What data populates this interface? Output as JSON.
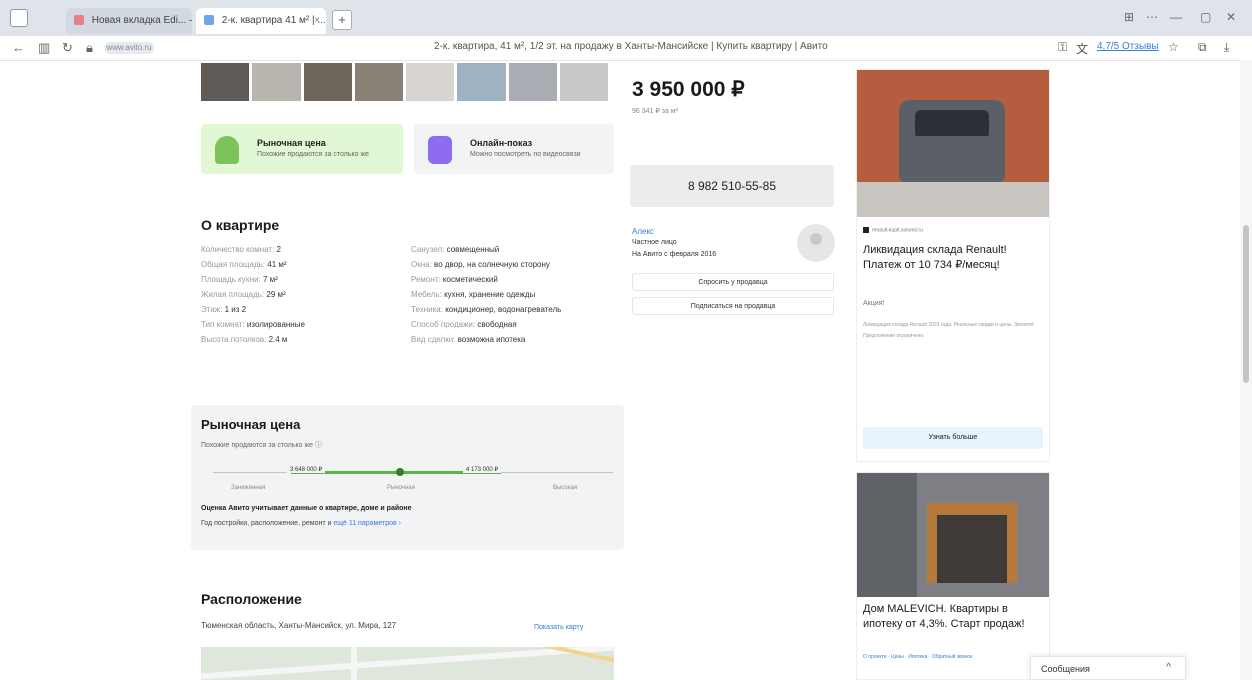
{
  "browser": {
    "tabs": [
      {
        "label": "Новая вкладка Edi... — Rev"
      },
      {
        "label": "2-к. квартира 41 м² | ..."
      }
    ],
    "new_tab": "+",
    "url": "www.avito.ru",
    "page_title": "2-к. квартира, 41 м², 1/2 эт. на продажу в Ханты-Мансийске | Купить квартиру | Авито",
    "rating": "4,7/5 Отзывы",
    "colors": {
      "accent": "#3a7bd5",
      "green": "#5bb648"
    }
  },
  "listing": {
    "market_badge": {
      "title": "Рыночная цена",
      "subtitle": "Похожие продаются за столько же"
    },
    "online_badge": {
      "title": "Онлайн-показ",
      "subtitle": "Можно посмотреть по видеосвязи"
    },
    "about": {
      "title": "О квартире",
      "left": [
        {
          "k": "Количество комнат:",
          "v": "2"
        },
        {
          "k": "Общая площадь:",
          "v": "41 м²"
        },
        {
          "k": "Площадь кухни:",
          "v": "7 м²"
        },
        {
          "k": "Жилая площадь:",
          "v": "29 м²"
        },
        {
          "k": "Этаж:",
          "v": "1 из 2"
        },
        {
          "k": "Тип комнат:",
          "v": "изолированные"
        },
        {
          "k": "Высота потолков:",
          "v": "2.4 м"
        }
      ],
      "right": [
        {
          "k": "Санузел:",
          "v": "совмещенный"
        },
        {
          "k": "Окна:",
          "v": "во двор, на солнечную сторону"
        },
        {
          "k": "Ремонт:",
          "v": "косметический"
        },
        {
          "k": "Мебель:",
          "v": "кухня, хранение одежды"
        },
        {
          "k": "Техника:",
          "v": "кондиционер, водонагреватель"
        },
        {
          "k": "Способ продажи:",
          "v": "свободная"
        },
        {
          "k": "Вид сделки:",
          "v": "возможна ипотека"
        }
      ]
    },
    "market": {
      "title": "Рыночная цена",
      "subtitle": "Похожие продаются за столько же ⓘ",
      "low": "3 648 000 ₽",
      "high": "4 173 000 ₽",
      "labels": [
        "Заниженная",
        "Рыночная",
        "Высокая"
      ],
      "position_percent": 52,
      "note": "Оценка Авито учитывает данные о квартире, доме и районе",
      "note2": "Год постройки, расположение, ремонт и ",
      "note2_link": "ещё 11 параметров ›"
    },
    "location": {
      "title": "Расположение",
      "address": "Тюменская область, Ханты-Мансийск, ул. Мира, 127",
      "map_link": "Показать карту"
    }
  },
  "sidebar": {
    "price": "3 950 000 ₽",
    "price_sub": "96 341 ₽ за м²",
    "phone": "8 982 510-55-85",
    "seller_name": "Алекс",
    "seller_type": "Частное лицо",
    "seller_since": "На Авито с февраля 2016",
    "btn_message": "Спросить у продавца",
    "btn_subscribe": "Подписаться на продавца"
  },
  "ads": {
    "ad1": {
      "source": "renault-kupit.avtomir.ru",
      "title": "Ликвидация склада Renault! Платеж от 10 734 ₽/месяц!",
      "tag": "Акция!",
      "desc": "Ликвидация склада Renault 2023 года. Реальные скидки и цены. Звоните! Предложение ограничено.",
      "button": "Узнать больше"
    },
    "ad2": {
      "title": "Дом MALEVICH. Квартиры в ипотеку от 4,3%. Старт продаж!",
      "meta": "О проекте · Цены · Ипотека · Обратный звонок"
    }
  },
  "chat": {
    "label": "Сообщения",
    "arrow": "^"
  }
}
